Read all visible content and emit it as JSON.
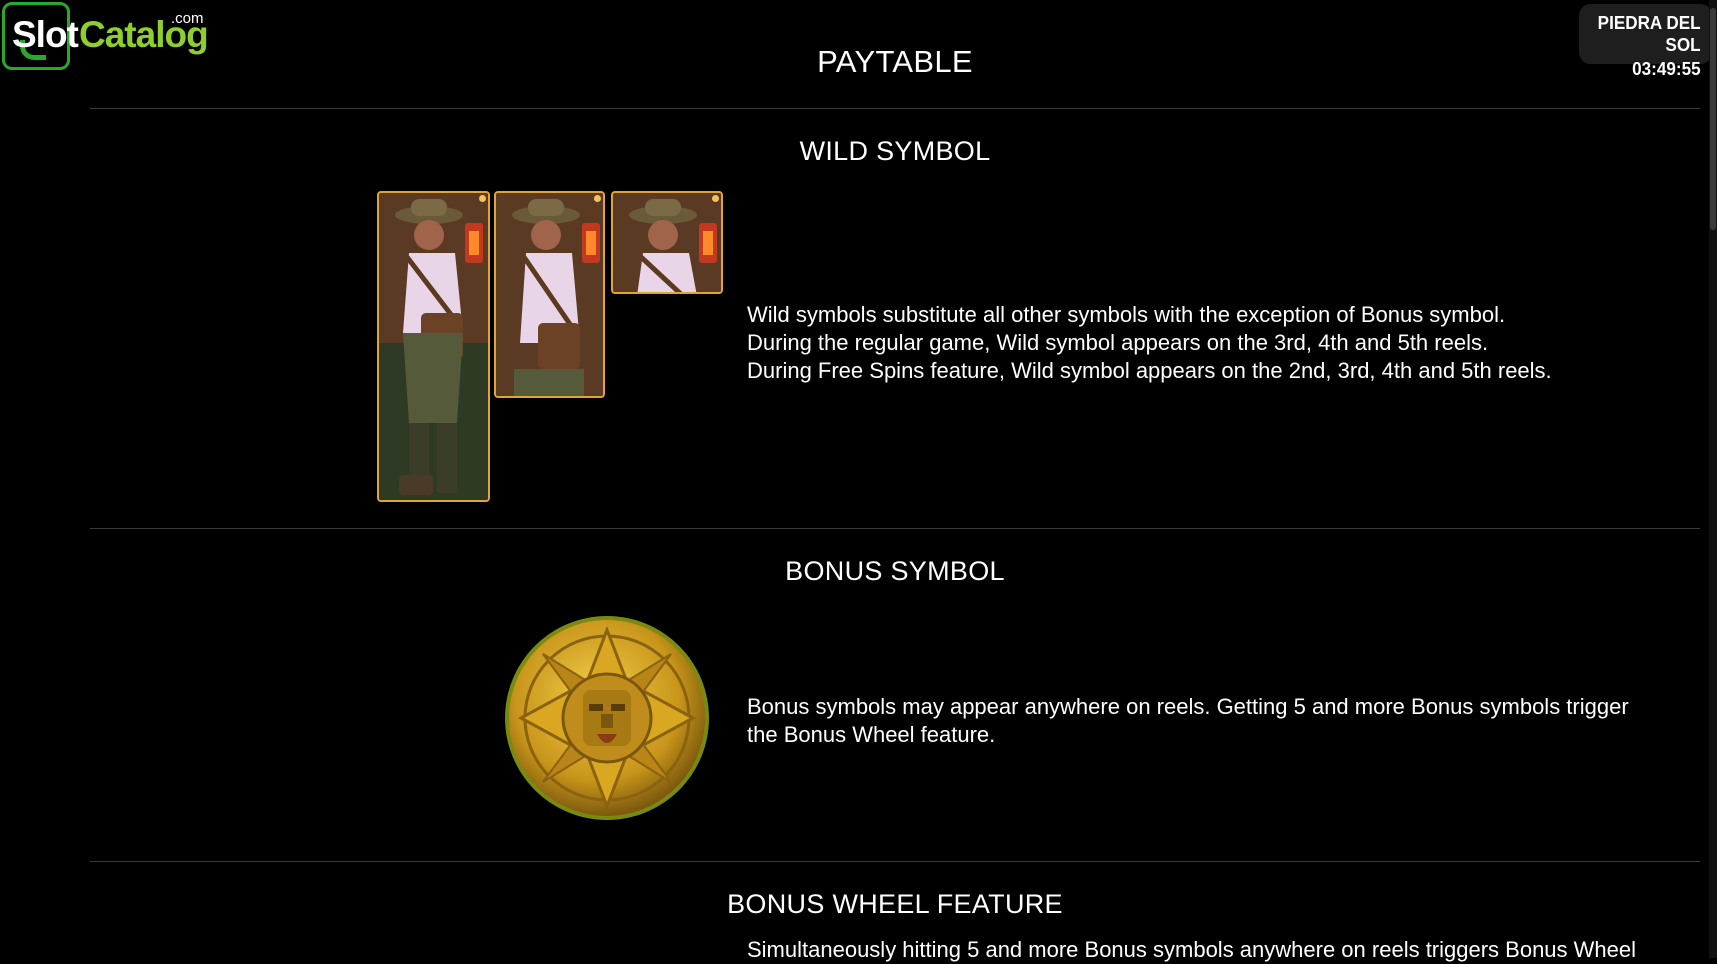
{
  "logo": {
    "slot": "Slot",
    "catalog": "Catalog",
    "com": ".com"
  },
  "badge": {
    "game_title": "PIEDRA DEL SOL",
    "time": "03:49:55"
  },
  "page_title": "PAYTABLE",
  "sections": {
    "wild": {
      "title": "WILD SYMBOL",
      "lines": [
        "Wild symbols substitute all other symbols with the exception of Bonus symbol.",
        "During the regular game, Wild symbol appears on the 3rd, 4th and 5th reels.",
        "During Free Spins feature, Wild symbol appears on the 2nd, 3rd, 4th and 5th reels."
      ]
    },
    "bonus": {
      "title": "BONUS SYMBOL",
      "lines": [
        "Bonus symbols may appear anywhere on reels. Getting 5 and more Bonus symbols trigger",
        "the Bonus Wheel feature."
      ]
    },
    "bonus_wheel": {
      "title": "BONUS WHEEL FEATURE",
      "lines": [
        "Simultaneously hitting 5 and more Bonus symbols anywhere on reels triggers Bonus Wheel"
      ]
    }
  },
  "colors": {
    "background": "#000000",
    "logo_green": "#2aa82a",
    "logo_lime": "#8fcf2d",
    "card_border": "#e0a43a",
    "coin_gold": "#d9a820"
  },
  "icons": {
    "wild": "explorer-woman-lantern",
    "bonus": "aztec-sun-stone-coin"
  }
}
